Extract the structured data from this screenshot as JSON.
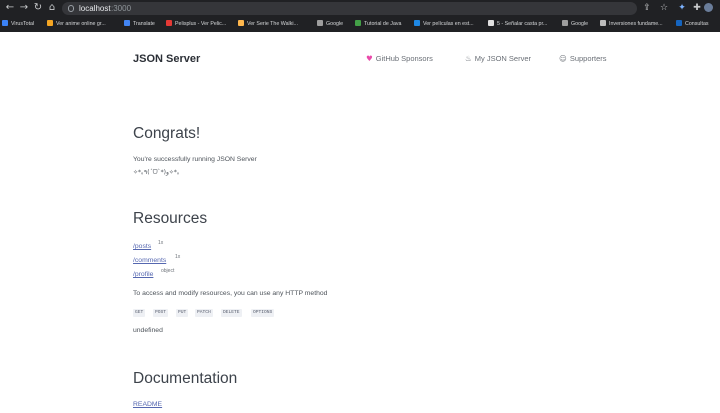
{
  "browser": {
    "url_host": "localhost",
    "url_port": ":3000",
    "bookmarks": [
      {
        "label": "VirusTotal",
        "color": "#3b82f6"
      },
      {
        "label": "Ver anime online gr...",
        "color": "#f5a623"
      },
      {
        "label": "Translate",
        "color": "#4285f4"
      },
      {
        "label": "Pelisplus - Ver Pelic...",
        "color": "#e53935"
      },
      {
        "label": "Ver Serie The Walki...",
        "color": "#ffb74d"
      },
      {
        "label": "Google",
        "color": "#9e9e9e"
      },
      {
        "label": "Tutorial de Java",
        "color": "#43a047"
      },
      {
        "label": "Ver películas en est...",
        "color": "#1e88e5"
      },
      {
        "label": "5 - Señalar casta pr...",
        "color": "#e0e0e0"
      },
      {
        "label": "Google",
        "color": "#9e9e9e"
      },
      {
        "label": "Inversiones fundame...",
        "color": "#bdbdbd"
      },
      {
        "label": "Consultas",
        "color": "#1565c0"
      }
    ]
  },
  "header": {
    "brand": "JSON Server",
    "nav": [
      {
        "icon": "heart-icon",
        "label": "GitHub Sponsors"
      },
      {
        "icon": "flame-icon",
        "label": "My JSON Server"
      },
      {
        "icon": "smile-icon",
        "label": "Supporters"
      }
    ]
  },
  "congrats": {
    "title": "Congrats!",
    "line1": "You're successfully running JSON Server",
    "line2": "✧*｡٩(ˊᗜˋ*)و✧*｡"
  },
  "resources": {
    "title": "Resources",
    "items": [
      {
        "name": "/posts",
        "count": "1x"
      },
      {
        "name": "/comments",
        "count": "1x"
      },
      {
        "name": "/profile",
        "count": "object"
      }
    ],
    "access_text": "To access and modify resources, you can use any HTTP method",
    "methods": [
      "GET",
      "POST",
      "PUT",
      "PATCH",
      "DELETE",
      "OPTIONS"
    ],
    "undefined_text": "undefined"
  },
  "documentation": {
    "title": "Documentation",
    "readme": "README"
  }
}
